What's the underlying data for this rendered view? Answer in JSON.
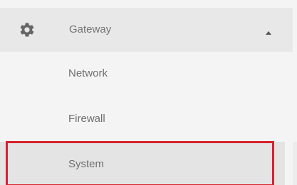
{
  "menu": {
    "header": {
      "icon": "gear-icon",
      "label": "Gateway",
      "caret_icon": "caret-up-icon"
    },
    "items": [
      {
        "label": "Network"
      },
      {
        "label": "Firewall"
      },
      {
        "label": "System",
        "highlighted": true
      }
    ]
  },
  "colors": {
    "header_bg": "#e8e8e8",
    "menu_bg": "#f4f4f4",
    "selected_bg": "#e4e4e4",
    "text": "#737373",
    "highlight_border": "#d6232d"
  }
}
